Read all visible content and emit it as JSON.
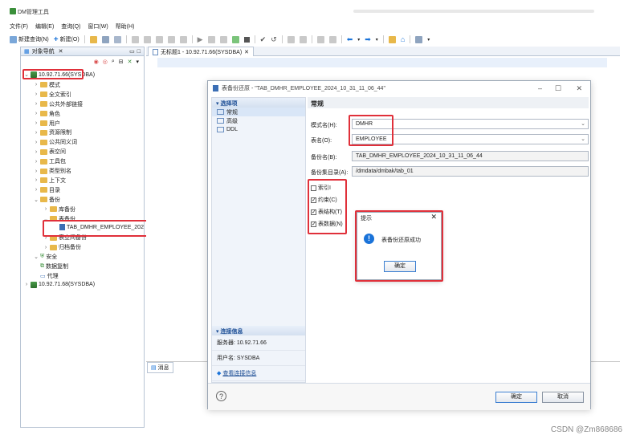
{
  "app": {
    "title": "DM管理工具"
  },
  "menu": [
    "文件(F)",
    "编辑(E)",
    "查询(Q)",
    "窗口(W)",
    "帮助(H)"
  ],
  "toolbar": {
    "new_query": "新建查询(N)",
    "new": "新建(O)"
  },
  "nav": {
    "title": "对象导航",
    "tree": [
      {
        "label": "10.92.71.66(SYSDBA)",
        "level": 0,
        "expanded": true,
        "type": "db"
      },
      {
        "label": "模式",
        "level": 1,
        "type": "folder"
      },
      {
        "label": "全文索引",
        "level": 1,
        "type": "folder"
      },
      {
        "label": "公共外部链接",
        "level": 1,
        "type": "folder"
      },
      {
        "label": "角色",
        "level": 1,
        "type": "folder"
      },
      {
        "label": "用户",
        "level": 1,
        "type": "folder"
      },
      {
        "label": "资源限制",
        "level": 1,
        "type": "folder"
      },
      {
        "label": "公共同义词",
        "level": 1,
        "type": "folder"
      },
      {
        "label": "表空间",
        "level": 1,
        "type": "folder"
      },
      {
        "label": "工具包",
        "level": 1,
        "type": "folder"
      },
      {
        "label": "类型别名",
        "level": 1,
        "type": "folder"
      },
      {
        "label": "上下文",
        "level": 1,
        "type": "folder"
      },
      {
        "label": "目录",
        "level": 1,
        "type": "folder"
      },
      {
        "label": "备份",
        "level": 1,
        "expanded": true,
        "type": "folder"
      },
      {
        "label": "库备份",
        "level": 2,
        "type": "folder"
      },
      {
        "label": "表备份",
        "level": 2,
        "expanded": true,
        "type": "folder"
      },
      {
        "label": "TAB_DMHR_EMPLOYEE_202",
        "level": 3,
        "type": "file"
      },
      {
        "label": "表空间备份",
        "level": 2,
        "type": "folder"
      },
      {
        "label": "归档备份",
        "level": 2,
        "type": "folder"
      },
      {
        "label": "安全",
        "level": 1,
        "expanded": true,
        "type": "shield"
      },
      {
        "label": "数据复制",
        "level": 1,
        "type": "copy"
      },
      {
        "label": "代理",
        "level": 1,
        "type": "agent"
      },
      {
        "label": "10.92.71.68(SYSDBA)",
        "level": 0,
        "type": "db"
      }
    ]
  },
  "editor": {
    "tab_label": "无标题1 - 10.92.71.66(SYSDBA)",
    "messages_tab": "消息"
  },
  "dialog": {
    "title": "表备份还原 - \"TAB_DMHR_EMPLOYEE_2024_10_31_11_06_44\"",
    "select_items_head": "选择项",
    "left_items": [
      "常规",
      "高级",
      "DDL"
    ],
    "connection_head": "连接信息",
    "server": "服务器: 10.92.71.66",
    "user": "用户名: SYSDBA",
    "view_conn": "查看连接信息",
    "section_title": "常规",
    "schema_label": "模式名(H):",
    "schema_value": "DMHR",
    "table_label": "表名(O):",
    "table_value": "EMPLOYEE",
    "backup_name_label": "备份名(B):",
    "backup_name_value": "TAB_DMHR_EMPLOYEE_2024_10_31_11_06_44",
    "backup_dir_label": "备份集目录(A):",
    "backup_dir_value": "/dmdata/dmbak/tab_01",
    "checkboxes": [
      {
        "label": "索引I",
        "checked": false
      },
      {
        "label": "约束(C)",
        "checked": true
      },
      {
        "label": "表结构(T)",
        "checked": true
      },
      {
        "label": "表数据(N)",
        "checked": true
      }
    ],
    "ok": "确定",
    "cancel": "取消"
  },
  "popup": {
    "title": "提示",
    "message": "表备份还原成功",
    "ok": "确定"
  },
  "watermark": "CSDN @Zm868686",
  "colors": {
    "highlight_red": "#e0303a",
    "accent_blue": "#1a73d9"
  }
}
